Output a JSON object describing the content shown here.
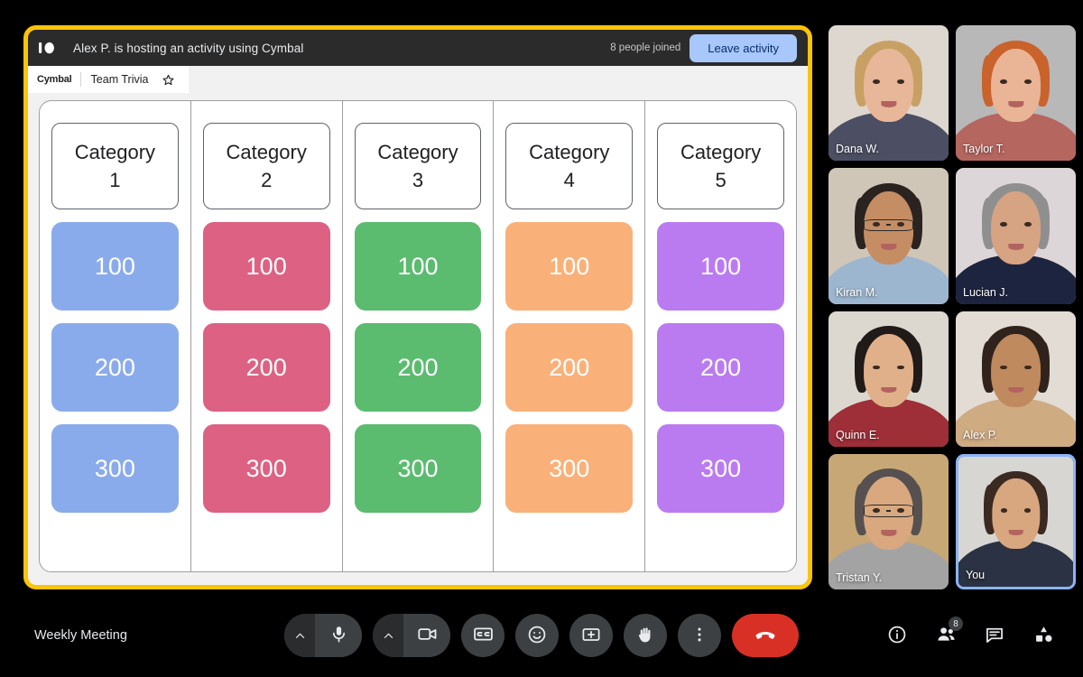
{
  "activity": {
    "logo_icon": "cymbal-logo-icon",
    "host_name": "Alex P.",
    "title_text": "Alex P. is hosting an activity using Cymbal",
    "joined_text": "8 people joined",
    "leave_label": "Leave activity",
    "breadcrumb": {
      "brand": "Cymbal",
      "name": "Team Trivia",
      "star_icon": "star-outline-icon"
    }
  },
  "board": {
    "columns": [
      {
        "category": "Category 1",
        "category_line1": "Category",
        "category_line2": "1",
        "color": "#8AABEB",
        "tiles": [
          "100",
          "200",
          "300"
        ]
      },
      {
        "category": "Category 2",
        "category_line1": "Category",
        "category_line2": "2",
        "color": "#DD6183",
        "tiles": [
          "100",
          "200",
          "300"
        ]
      },
      {
        "category": "Category 3",
        "category_line1": "Category",
        "category_line2": "3",
        "color": "#5BBB6F",
        "tiles": [
          "100",
          "200",
          "300"
        ]
      },
      {
        "category": "Category 4",
        "category_line1": "Category",
        "category_line2": "4",
        "color": "#F9B179",
        "tiles": [
          "100",
          "200",
          "300"
        ]
      },
      {
        "category": "Category 5",
        "category_line1": "Category",
        "category_line2": "5",
        "color": "#BB7BF0",
        "tiles": [
          "100",
          "200",
          "300"
        ]
      }
    ]
  },
  "participants": [
    {
      "name": "Dana W.",
      "self": false
    },
    {
      "name": "Taylor T.",
      "self": false
    },
    {
      "name": "Kiran M.",
      "self": false
    },
    {
      "name": "Lucian J.",
      "self": false
    },
    {
      "name": "Quinn E.",
      "self": false
    },
    {
      "name": "Alex P.",
      "self": false
    },
    {
      "name": "Tristan Y.",
      "self": false
    },
    {
      "name": "You",
      "self": true
    }
  ],
  "bottom_bar": {
    "meeting_name": "Weekly Meeting",
    "controls": [
      {
        "name": "microphone",
        "icon": "microphone-icon",
        "has_chevron": true
      },
      {
        "name": "camera",
        "icon": "video-camera-icon",
        "has_chevron": true
      },
      {
        "name": "captions",
        "icon": "closed-captions-icon",
        "has_chevron": false
      },
      {
        "name": "reactions",
        "icon": "emoji-smiley-icon",
        "has_chevron": false
      },
      {
        "name": "present",
        "icon": "present-screen-icon",
        "has_chevron": false
      },
      {
        "name": "raise-hand",
        "icon": "raised-hand-icon",
        "has_chevron": false
      },
      {
        "name": "more-options",
        "icon": "more-vertical-icon",
        "has_chevron": false
      }
    ],
    "hangup": {
      "name": "leave-call",
      "icon": "phone-hangup-icon"
    },
    "right_controls": [
      {
        "name": "meeting-details",
        "icon": "info-circle-icon",
        "badge": ""
      },
      {
        "name": "participants",
        "icon": "people-icon",
        "badge": "8"
      },
      {
        "name": "chat",
        "icon": "chat-bubble-icon",
        "badge": ""
      },
      {
        "name": "activities",
        "icon": "activities-shapes-icon",
        "badge": ""
      }
    ]
  },
  "colors": {
    "activity_highlight": "#FCC409",
    "accent_blue": "#A8C7FA",
    "hangup_red": "#D93025",
    "self_tile_border": "#8AB4F8"
  }
}
